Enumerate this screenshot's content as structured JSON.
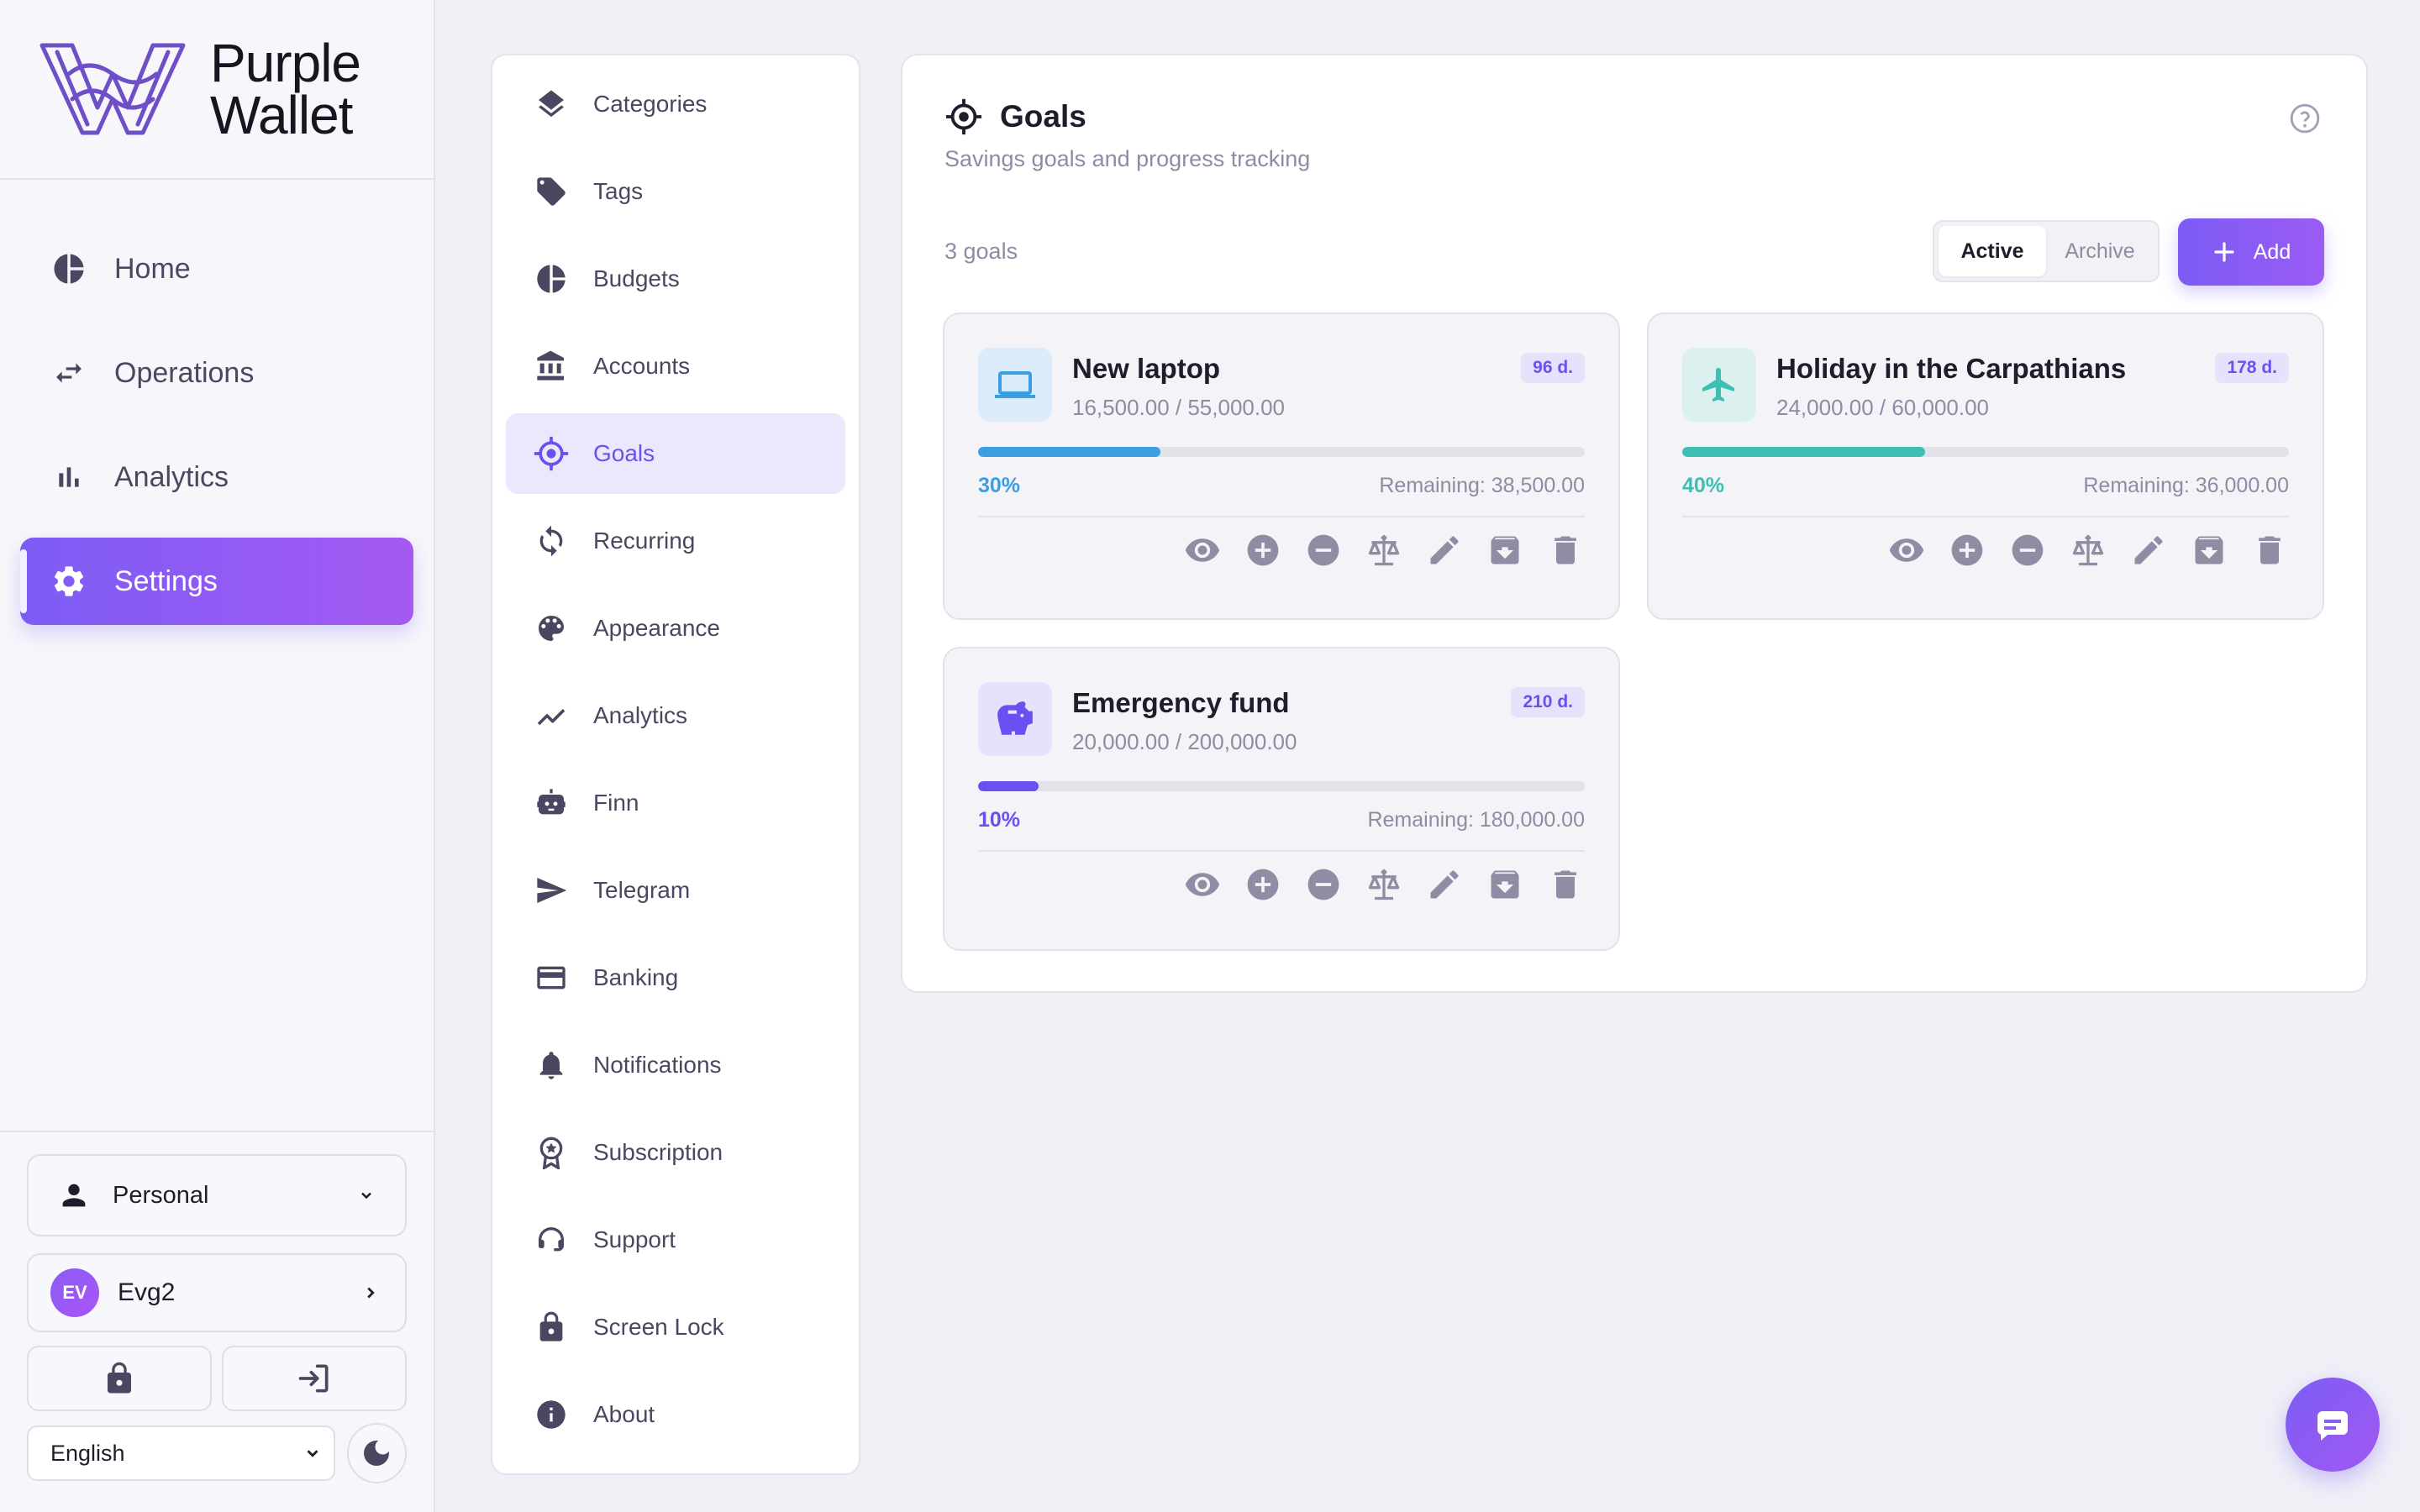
{
  "brand": {
    "name_line1": "Purple",
    "name_line2": "Wallet"
  },
  "nav": {
    "items": [
      {
        "label": "Home",
        "icon": "pie-chart-icon"
      },
      {
        "label": "Operations",
        "icon": "swap-arrows-icon"
      },
      {
        "label": "Analytics",
        "icon": "bar-chart-icon"
      },
      {
        "label": "Settings",
        "icon": "gear-icon",
        "active": true
      }
    ]
  },
  "sidebar_bottom": {
    "profile": "Personal",
    "user": {
      "initials": "EV",
      "name": "Evg2"
    },
    "language": "English"
  },
  "submenu": {
    "items": [
      {
        "label": "Categories",
        "icon": "layers-icon"
      },
      {
        "label": "Tags",
        "icon": "tag-icon"
      },
      {
        "label": "Budgets",
        "icon": "pie-chart-icon"
      },
      {
        "label": "Accounts",
        "icon": "bank-icon"
      },
      {
        "label": "Goals",
        "icon": "target-icon",
        "active": true
      },
      {
        "label": "Recurring",
        "icon": "repeat-icon"
      },
      {
        "label": "Appearance",
        "icon": "palette-icon"
      },
      {
        "label": "Analytics",
        "icon": "trend-line-icon"
      },
      {
        "label": "Finn",
        "icon": "robot-icon"
      },
      {
        "label": "Telegram",
        "icon": "send-icon"
      },
      {
        "label": "Banking",
        "icon": "credit-card-icon"
      },
      {
        "label": "Notifications",
        "icon": "bell-icon"
      },
      {
        "label": "Subscription",
        "icon": "badge-icon"
      },
      {
        "label": "Support",
        "icon": "headset-icon"
      },
      {
        "label": "Screen Lock",
        "icon": "lock-icon"
      },
      {
        "label": "About",
        "icon": "info-icon"
      }
    ]
  },
  "goals_panel": {
    "title": "Goals",
    "subtitle": "Savings goals and progress tracking",
    "count_text": "3 goals",
    "tabs": {
      "active": "Active",
      "archive": "Archive",
      "selected": "Active"
    },
    "add_label": "Add",
    "goals": [
      {
        "name": "New laptop",
        "icon": "laptop-icon",
        "amount": "16,500.00 / 55,000.00",
        "days": "96 d.",
        "percent_label": "30%",
        "progress": 0.3,
        "remaining": "Remaining: 38,500.00",
        "color": "#3b9ee3",
        "icon_bg": "#dcebfa"
      },
      {
        "name": "Holiday in the Carpathians",
        "icon": "airplane-icon",
        "amount": "24,000.00 / 60,000.00",
        "days": "178 d.",
        "percent_label": "40%",
        "progress": 0.4,
        "remaining": "Remaining: 36,000.00",
        "color": "#3fbfb4",
        "icon_bg": "#dcf1ef"
      },
      {
        "name": "Emergency fund",
        "icon": "piggy-bank-icon",
        "amount": "20,000.00 / 200,000.00",
        "days": "210 d.",
        "percent_label": "10%",
        "progress": 0.1,
        "remaining": "Remaining: 180,000.00",
        "color": "#6b4ff0",
        "icon_bg": "#e6e2fb"
      }
    ],
    "actions": [
      "eye-icon",
      "plus-circle-icon",
      "minus-circle-icon",
      "balance-scale-icon",
      "pencil-icon",
      "archive-icon",
      "trash-icon"
    ]
  },
  "colors": {
    "accent": "#7c5cf5",
    "accent_2": "#a45af2"
  }
}
